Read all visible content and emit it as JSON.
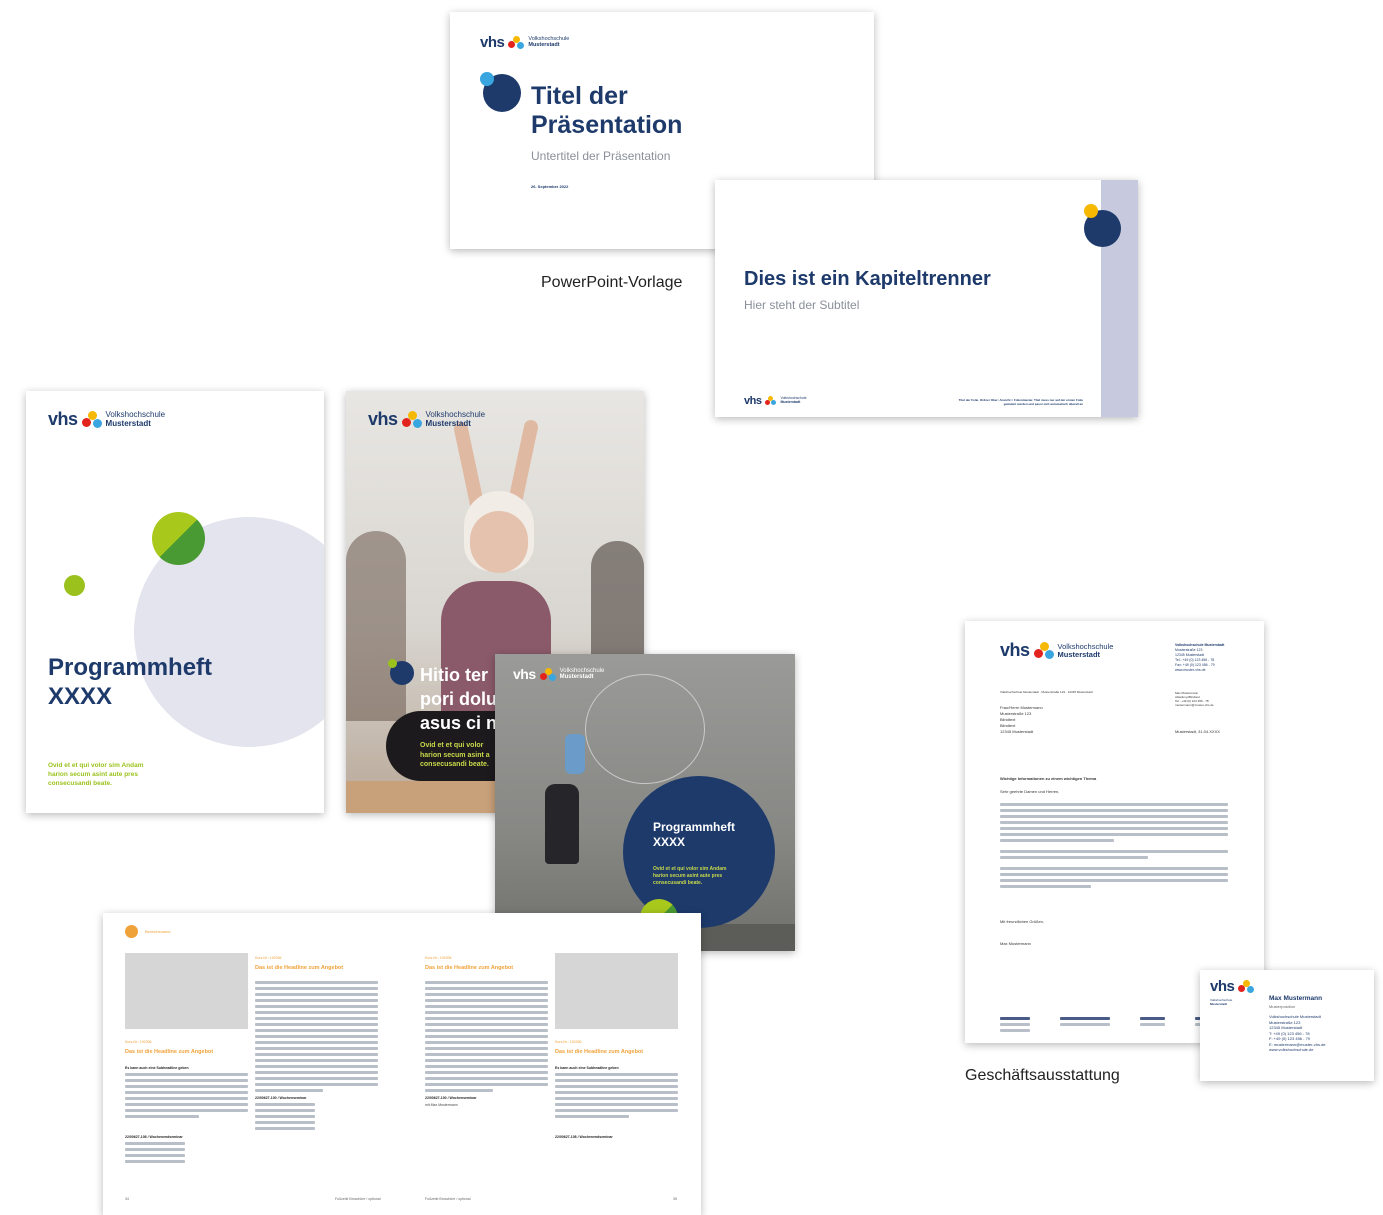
{
  "logo": {
    "brand": "vhs",
    "org_line1": "Volkshochschule",
    "org_line2": "Musterstadt"
  },
  "colors": {
    "navy": "#1d3a6b",
    "lavender": "#c7cade",
    "lime": "#9bc11c",
    "green": "#4a9a33",
    "orange": "#f0a23a",
    "yellow": "#f6b800",
    "red": "#e2241d",
    "blue": "#3aa6e0"
  },
  "slide_title": {
    "title_line1": "Titel der",
    "title_line2": "Präsentation",
    "subtitle": "Untertitel der Präsentation",
    "date": "26. September 2022"
  },
  "slide_chapter": {
    "title": "Dies ist ein Kapiteltrenner",
    "subtitle": "Hier steht der Subtitel",
    "footer_note_line1": "Titel der Folie. Ordner Ober: Ansicht > Folienmaster. Titel muss nur auf der ersten Folie",
    "footer_note_line2": "geändert werden und passt sich automatisch überall an"
  },
  "captions": {
    "powerpoint": "PowerPoint-Vorlage",
    "business": "Geschäftsausstattung"
  },
  "programm_plain": {
    "title_line1": "Programmheft",
    "title_line2": "XXXX",
    "tagline_line1": "Ovid et et qui volor sim Andam",
    "tagline_line2": "harion secum asint aute pres",
    "tagline_line3": "consecusandi beate."
  },
  "programm_photo": {
    "headline_line1": "Hitio ter",
    "headline_line2": "pori dolu",
    "headline_line3": "asus ci n",
    "tagline_line1": "Ovid et et qui volor",
    "tagline_line2": "harion secum asint a",
    "tagline_line3": "consecusandi beate."
  },
  "programm_wall": {
    "title_line1": "Programmheft",
    "title_line2": "XXXX",
    "tagline_line1": "Ovid et et qui volor sim Andam",
    "tagline_line2": "harion secum asint aute pres",
    "tagline_line3": "consecusandi beate."
  },
  "brochure": {
    "section_label": "Bereichsname",
    "course_no": "Kurs-Nr.: 192306",
    "headline": "Das ist die Headline zum Angebot",
    "sub_headline": "Es kann auch eine Subheadline geben",
    "event1": "22/00627-100 / Wochenseminar",
    "event2": "22/00627-108 / Wochenendseminar",
    "trainer": "mit Max Mustermann",
    "footer_left": "Fußzeile Broschüre / optional",
    "footer_right": "Fußzeile Broschüre / optional",
    "page_left": "34",
    "page_right": "35"
  },
  "letter": {
    "sender_name": "Volkshochschule Musterstadt",
    "sender_street": "Musterstraße 123",
    "sender_city": "12345 Musterstadt",
    "sender_tel": "Tel.: +49 (0) 123 456 - 78",
    "sender_fax": "Fax: +49 (0) 123 456 - 79",
    "sender_web": "www.muster-vhs.de",
    "return_line": "Volkshochschule Musterstadt · Musterstraße 123 · 12345 Musterstadt",
    "recipient": [
      "Frau/Herrn Mustermann",
      "Musterstraße 123",
      "Blindtext",
      "Blindtext",
      "12345 Musterstadt"
    ],
    "contact": [
      "Max Mustermann",
      "Abteilung Blindtext",
      "Tel.: +49 (0) 123 456 - 78",
      "mustermann@muster-vhs.de"
    ],
    "date": "Musterstadt, 31.04.XXXX",
    "subject": "Wichtige Informationen zu einem wichtigen Thema",
    "salutation": "Sehr geehrte Damen und Herren,",
    "closing": "Mit freundlichen Grüßen,",
    "signature": "Max Mustermann"
  },
  "business_card": {
    "name": "Max Mustermann",
    "position": "Musterposition",
    "org": "Volkshochschule Musterstadt",
    "street": "Musterstraße 123",
    "city": "12345 Musterstadt",
    "phone": "T:  +49 (0) 123 456 - 78",
    "fax": "F:  +49 (0) 123 456 - 79",
    "email": "E:  mustermann@muster-vhs.de",
    "web": "www.volkshochschule.de"
  }
}
